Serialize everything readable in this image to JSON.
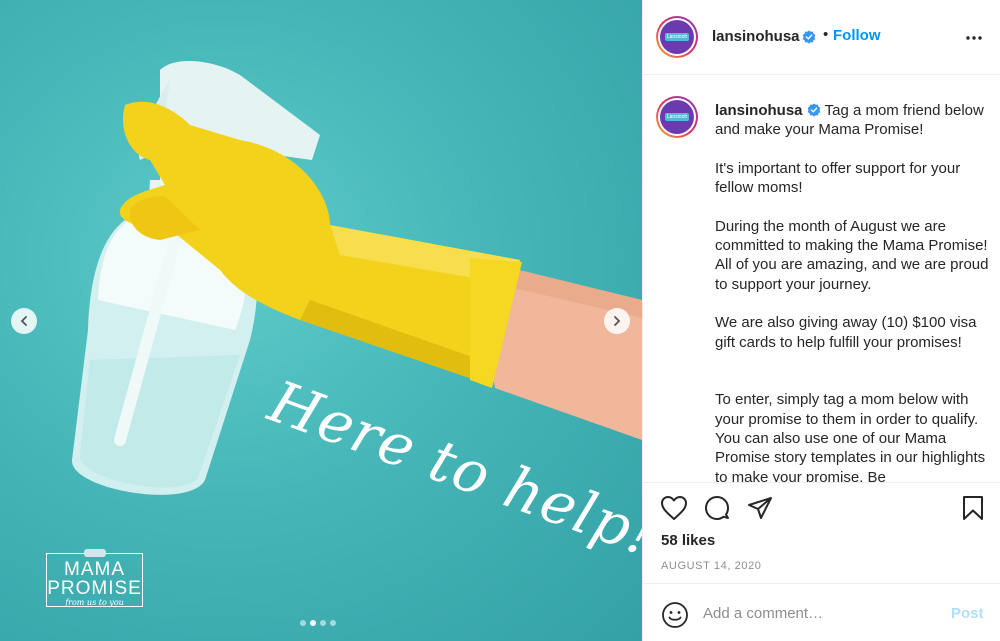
{
  "post": {
    "image_overlay_text": "Here to help!",
    "logo": {
      "line1": "MAMA",
      "line2": "PROMISE",
      "tagline": "from us to you"
    },
    "carousel": {
      "count": 4,
      "active_index": 1
    }
  },
  "header": {
    "username": "lansinohusa",
    "separator": "•",
    "follow_label": "Follow",
    "avatar_text": "Lansinoh"
  },
  "caption": {
    "username": "lansinohusa",
    "paragraphs": [
      "Tag a mom friend below and make your Mama Promise!",
      "It's important to offer support for your fellow moms!",
      "During the month of August we are committed to making the Mama Promise! All of you are amazing, and we are proud to support your journey.",
      "We are also giving away (10) $100 visa gift cards to help fulfill your promises!",
      "To enter, simply tag a mom below with your promise to them in order to qualify. You can also use one of our Mama Promise story templates in our highlights to make your promise. Be"
    ]
  },
  "engagement": {
    "likes": "58 likes",
    "date": "AUGUST 14, 2020"
  },
  "comment": {
    "placeholder": "Add a comment…",
    "post_label": "Post"
  },
  "colors": {
    "accent": "#0095f6",
    "post_disabled": "#b2dffc",
    "background_teal": "#46b6b8",
    "glove_yellow": "#f3d21c"
  },
  "icons": [
    "verified-badge-icon",
    "more-options-icon",
    "heart-icon",
    "comment-icon",
    "share-icon",
    "bookmark-icon",
    "emoji-icon",
    "chevron-left-icon",
    "chevron-right-icon"
  ]
}
